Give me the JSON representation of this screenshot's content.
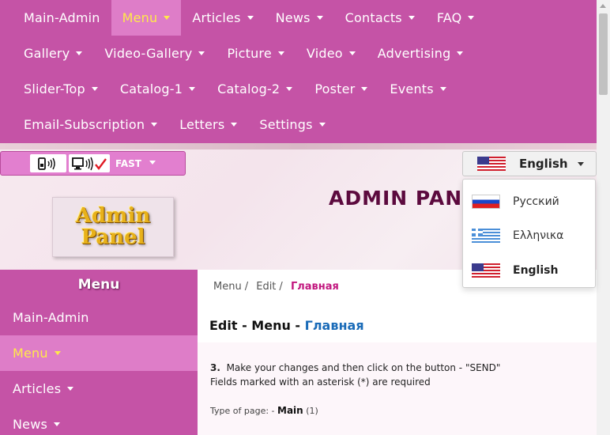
{
  "nav": {
    "rows": [
      [
        {
          "label": "Main-Admin",
          "caret": false,
          "active": false
        },
        {
          "label": "Menu",
          "caret": true,
          "active": true
        },
        {
          "label": "Articles",
          "caret": true,
          "active": false
        },
        {
          "label": "News",
          "caret": true,
          "active": false
        },
        {
          "label": "Contacts",
          "caret": true,
          "active": false
        },
        {
          "label": "FAQ",
          "caret": true,
          "active": false
        }
      ],
      [
        {
          "label": "Gallery",
          "caret": true,
          "active": false
        },
        {
          "label": "Video-Gallery",
          "caret": true,
          "active": false
        },
        {
          "label": "Picture",
          "caret": true,
          "active": false
        },
        {
          "label": "Video",
          "caret": true,
          "active": false
        },
        {
          "label": "Advertising",
          "caret": true,
          "active": false
        }
      ],
      [
        {
          "label": "Slider-Top",
          "caret": true,
          "active": false
        },
        {
          "label": "Catalog-1",
          "caret": true,
          "active": false
        },
        {
          "label": "Catalog-2",
          "caret": true,
          "active": false
        },
        {
          "label": "Poster",
          "caret": true,
          "active": false
        },
        {
          "label": "Events",
          "caret": true,
          "active": false
        }
      ],
      [
        {
          "label": "Email-Subscription",
          "caret": true,
          "active": false
        },
        {
          "label": "Letters",
          "caret": true,
          "active": false
        },
        {
          "label": "Settings",
          "caret": true,
          "active": false
        }
      ]
    ]
  },
  "toolbar": {
    "fast_label": "FAST"
  },
  "language": {
    "current": "English",
    "options": [
      "Русский",
      "Ελληνικα",
      "English"
    ]
  },
  "header": {
    "title": "ADMIN PANEL",
    "logo_line1": "Admin",
    "logo_line2": "Panel"
  },
  "sidebar": {
    "title": "Menu",
    "items": [
      {
        "label": "Main-Admin",
        "caret": false,
        "active": false
      },
      {
        "label": "Menu",
        "caret": true,
        "active": true
      },
      {
        "label": "Articles",
        "caret": true,
        "active": false
      },
      {
        "label": "News",
        "caret": true,
        "active": false
      }
    ]
  },
  "breadcrumb": {
    "items": [
      "Menu",
      "Edit"
    ],
    "current": "Главная"
  },
  "main": {
    "title_prefix": "Edit - Menu - ",
    "title_highlight": "Главная",
    "step_number": "3.",
    "instruction_line1": "Make your changes and then click on the button - \"SEND\"",
    "instruction_line2": "Fields marked with an asterisk (*) are required",
    "page_type_label": "Type of page: - ",
    "page_type_value": "Main",
    "page_type_count": "(1)"
  },
  "colors": {
    "nav_bg": "#c553a6",
    "nav_active_bg": "#de7dc8",
    "nav_active_text": "#ffe94a",
    "title_dark": "#5c0a3e",
    "breadcrumb_current": "#c2187f",
    "title_blue": "#1a6bb8"
  }
}
